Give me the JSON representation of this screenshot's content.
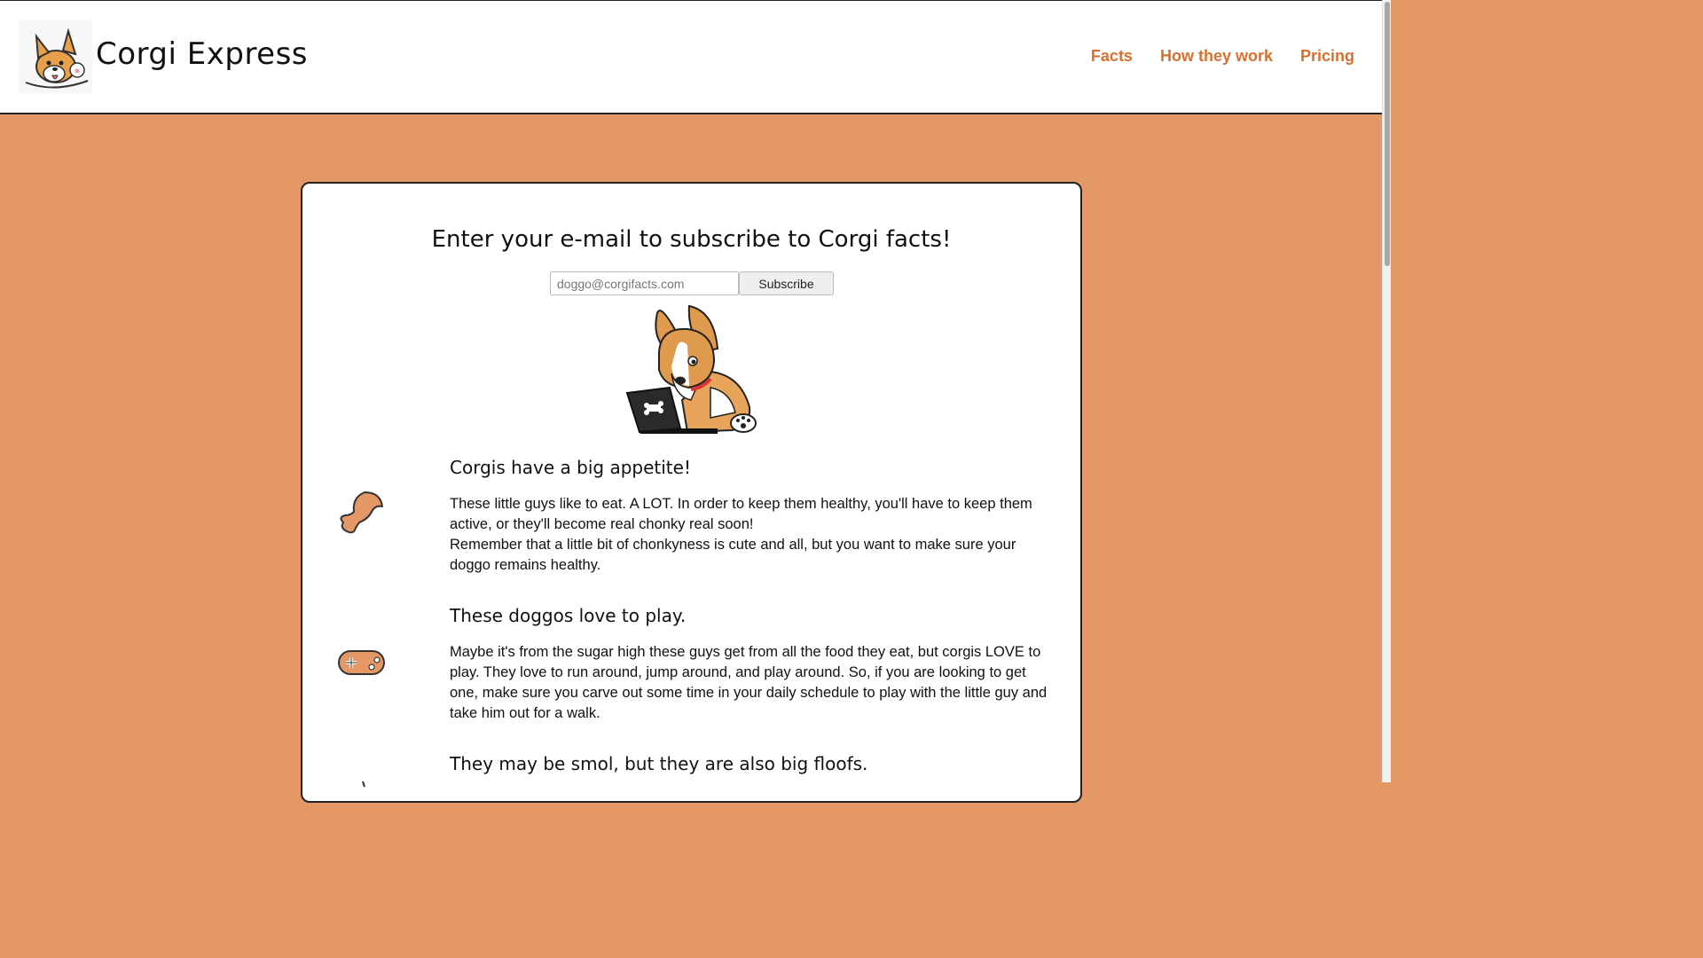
{
  "header": {
    "brand": "Corgi Express",
    "nav": [
      "Facts",
      "How they work",
      "Pricing"
    ]
  },
  "subscribe": {
    "heading": "Enter your e-mail to subscribe to Corgi facts!",
    "placeholder": "doggo@corgifacts.com",
    "button": "Subscribe"
  },
  "facts": [
    {
      "icon": "drumstick-icon",
      "title": "Corgis have a big appetite!",
      "lines": [
        "These little guys like to eat. A LOT. In order to keep them healthy, you'll have to keep them active, or they'll become real chonky real soon!",
        "Remember that a little bit of chonkyness is cute and all, but you want to make sure your doggo remains healthy."
      ]
    },
    {
      "icon": "gamepad-icon",
      "title": "These doggos love to play.",
      "lines": [
        "Maybe it's from the sugar high these guys get from all the food they eat, but corgis LOVE to play. They love to run around, jump around, and play around. So, if you are looking to get one, make sure you carve out some time in your daily schedule to play with the little guy and take him out for a walk."
      ]
    },
    {
      "icon": "fluff-icon",
      "title": "They may be smol, but they are also big floofs.",
      "lines": []
    }
  ],
  "colors": {
    "accent": "#d9702e",
    "background": "#e49866",
    "icon_fill": "#e49866"
  }
}
